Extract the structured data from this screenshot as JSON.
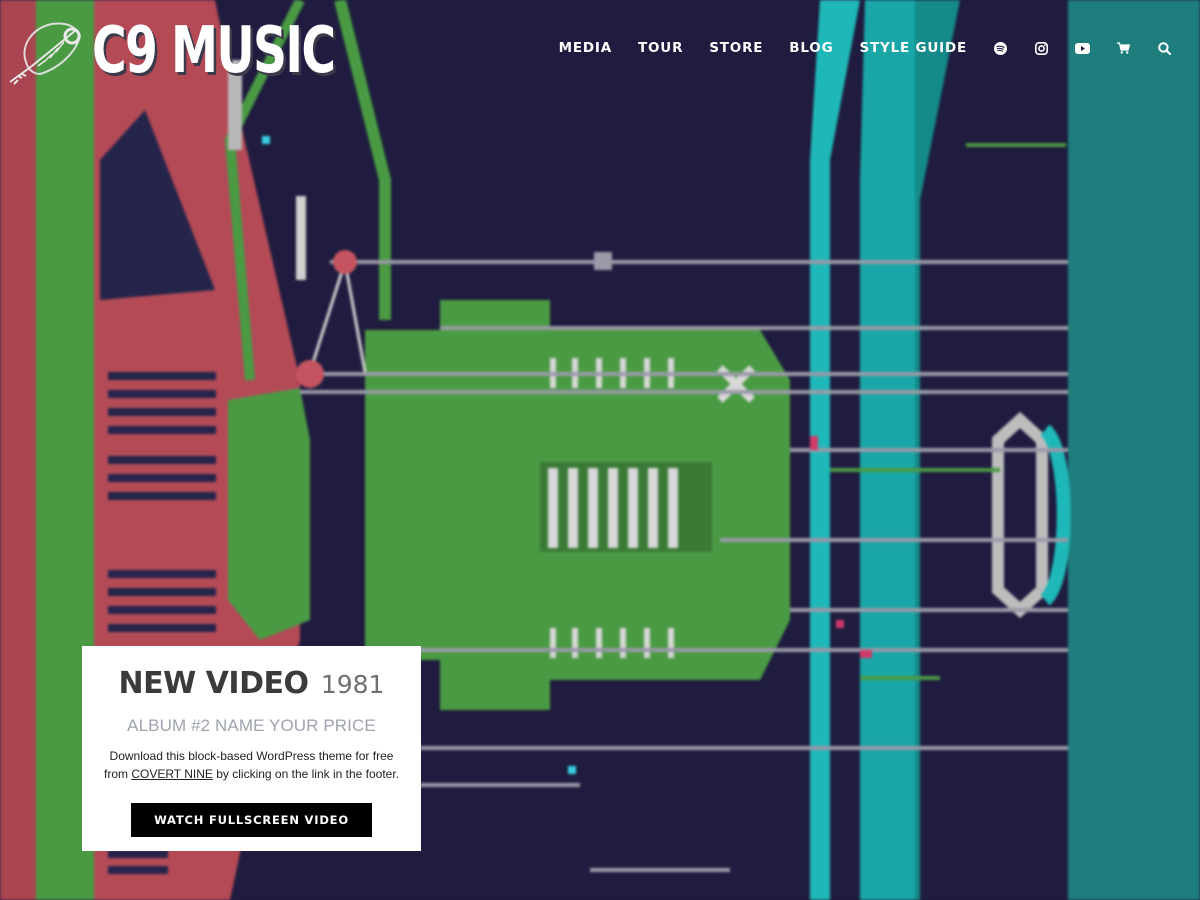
{
  "brand": {
    "name": "C9 MUSIC",
    "logo_icon": "feather-key-icon"
  },
  "nav": {
    "links": [
      "MEDIA",
      "TOUR",
      "STORE",
      "BLOG",
      "STYLE GUIDE"
    ],
    "icons": [
      "spotify-icon",
      "instagram-icon",
      "youtube-icon",
      "cart-icon",
      "search-icon"
    ]
  },
  "hero": {
    "colors": {
      "background": "#1f1c3f",
      "red": "#b34a56",
      "green": "#4a9a44",
      "teal": "#1e8c8a",
      "gray": "#9a9aa8"
    }
  },
  "feature": {
    "title_bold": "NEW VIDEO",
    "title_light": "1981",
    "subtitle": "ALBUM #2 NAME YOUR PRICE",
    "desc_before": "Download this block-based WordPress theme for free from ",
    "desc_link": "COVERT NINE",
    "desc_after": " by clicking on the link in the footer.",
    "button_label": "WATCH FULLSCREEN VIDEO"
  }
}
